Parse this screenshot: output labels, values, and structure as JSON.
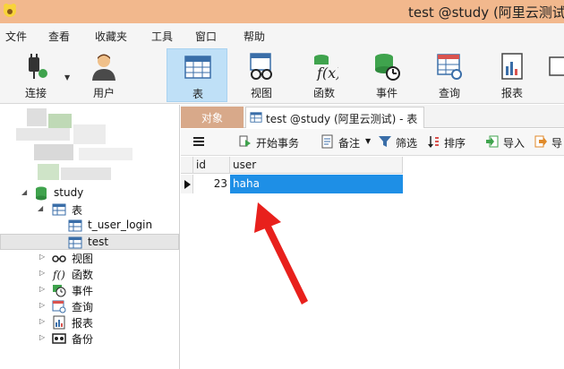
{
  "window": {
    "title": "test @study (阿里云测试)"
  },
  "menu": [
    "文件",
    "查看",
    "收藏夹",
    "工具",
    "窗口",
    "帮助"
  ],
  "toolbar": {
    "connect": "连接",
    "user": "用户",
    "table": "表",
    "view": "视图",
    "function": "函数",
    "event": "事件",
    "query": "查询",
    "report": "报表"
  },
  "tabs": {
    "objects": "对象",
    "doc": "test @study (阿里云测试) - 表"
  },
  "subtoolbar": {
    "begin_transaction": "开始事务",
    "memo": "备注",
    "filter": "筛选",
    "sort": "排序",
    "import": "导入",
    "export": "导"
  },
  "tree": {
    "db": "study",
    "tables": "表",
    "table_items": [
      "t_user_login",
      "test"
    ],
    "views": "视图",
    "functions": "函数",
    "events": "事件",
    "queries": "查询",
    "reports": "报表",
    "backups": "备份"
  },
  "grid": {
    "columns": [
      "id",
      "user"
    ],
    "rows": [
      {
        "id": "23",
        "user": "haha"
      }
    ]
  },
  "colors": {
    "titlebar": "#f2b88d",
    "selection": "#1e8fe6",
    "active_tab_bg": "#bfe0f7",
    "annotation": "#e8201c"
  }
}
